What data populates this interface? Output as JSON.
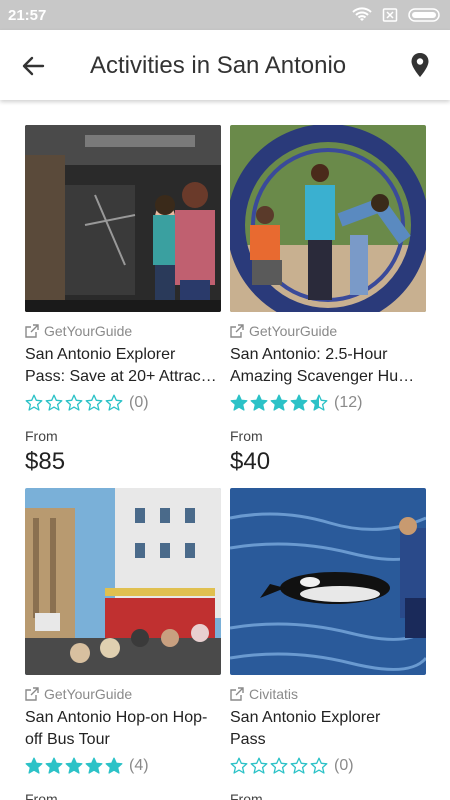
{
  "status": {
    "time": "21:57"
  },
  "header": {
    "title": "Activities in San Antonio"
  },
  "colors": {
    "accent": "#2cc2c7",
    "text": "#222222",
    "muted": "#8a8a8a"
  },
  "cards": [
    {
      "provider": "GetYourGuide",
      "title_line1": "San Antonio Explorer",
      "title_line2": "Pass: Save at 20+ Attrac…",
      "rating": 0,
      "count": "(0)",
      "from": "From",
      "price": "$85"
    },
    {
      "provider": "GetYourGuide",
      "title_line1": "San Antonio: 2.5-Hour",
      "title_line2": "Amazing Scavenger Hu…",
      "rating": 4.5,
      "count": "(12)",
      "from": "From",
      "price": "$40"
    },
    {
      "provider": "GetYourGuide",
      "title_line1": "San Antonio Hop-on Hop-",
      "title_line2": "off Bus Tour",
      "rating": 5,
      "count": "(4)",
      "from": "From",
      "price": ""
    },
    {
      "provider": "Civitatis",
      "title_line1": "San Antonio Explorer",
      "title_line2": "Pass",
      "rating": 0,
      "count": "(0)",
      "from": "From",
      "price": ""
    }
  ]
}
